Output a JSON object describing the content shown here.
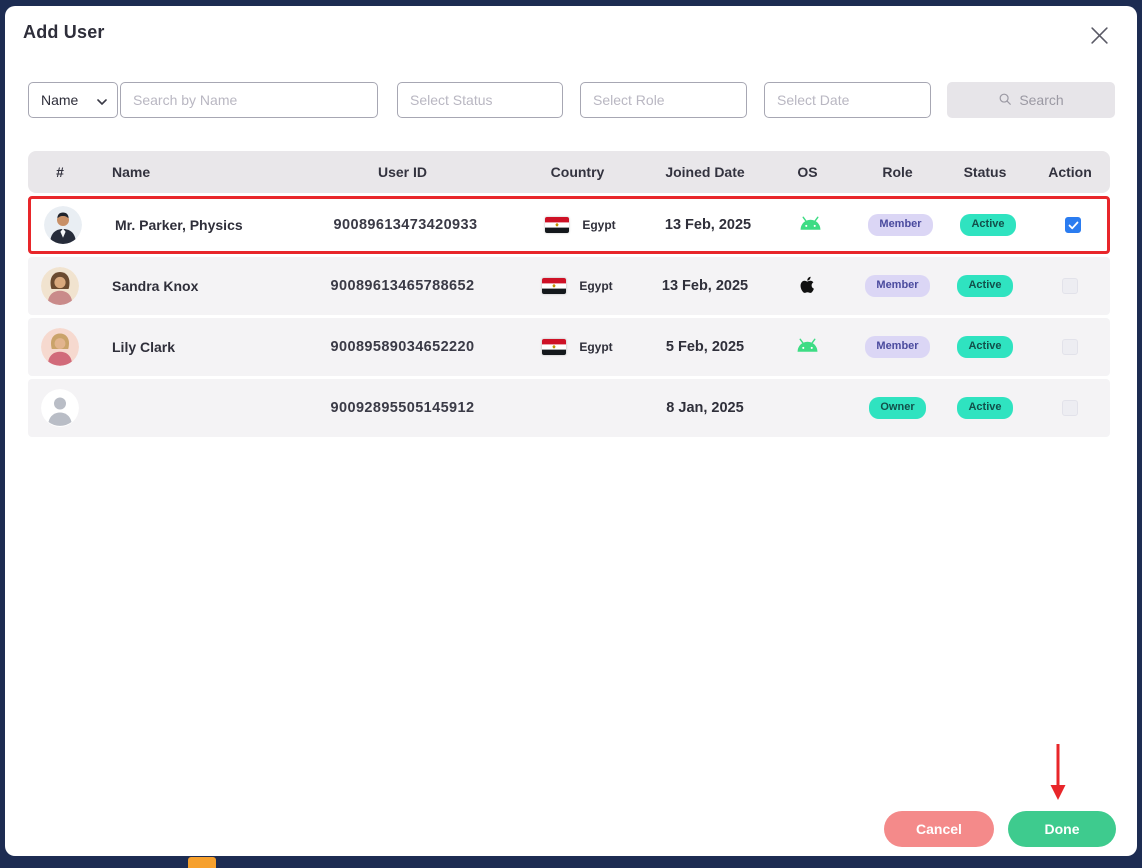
{
  "modal": {
    "title": "Add User"
  },
  "filters": {
    "field_select_value": "Name",
    "name_placeholder": "Search by Name",
    "status_placeholder": "Select Status",
    "role_placeholder": "Select Role",
    "date_placeholder": "Select Date",
    "search_label": "Search"
  },
  "table": {
    "headers": [
      "#",
      "Name",
      "User ID",
      "Country",
      "Joined Date",
      "OS",
      "Role",
      "Status",
      "Action"
    ],
    "rows": [
      {
        "name": "Mr. Parker, Physics",
        "user_id": "90089613473420933",
        "country": "Egypt",
        "joined": "13 Feb, 2025",
        "os": "android",
        "role": "Member",
        "status": "Active",
        "selected": true
      },
      {
        "name": "Sandra Knox",
        "user_id": "90089613465788652",
        "country": "Egypt",
        "joined": "13 Feb, 2025",
        "os": "apple",
        "role": "Member",
        "status": "Active",
        "selected": false
      },
      {
        "name": "Lily Clark",
        "user_id": "90089589034652220",
        "country": "Egypt",
        "joined": "5 Feb, 2025",
        "os": "android",
        "role": "Member",
        "status": "Active",
        "selected": false
      },
      {
        "name": "",
        "user_id": "90092895505145912",
        "country": "",
        "joined": "8 Jan, 2025",
        "os": "",
        "role": "Owner",
        "status": "Active",
        "selected": false
      }
    ]
  },
  "footer": {
    "cancel_label": "Cancel",
    "done_label": "Done"
  },
  "colors": {
    "frame": "#1d2c52",
    "highlight_border": "#e8262a",
    "active_badge": "#2fe3c0",
    "member_badge": "#dbd6f5",
    "checkbox_checked": "#2b7cf0",
    "cancel_button": "#f48a8a",
    "done_button": "#3ecb8e"
  }
}
